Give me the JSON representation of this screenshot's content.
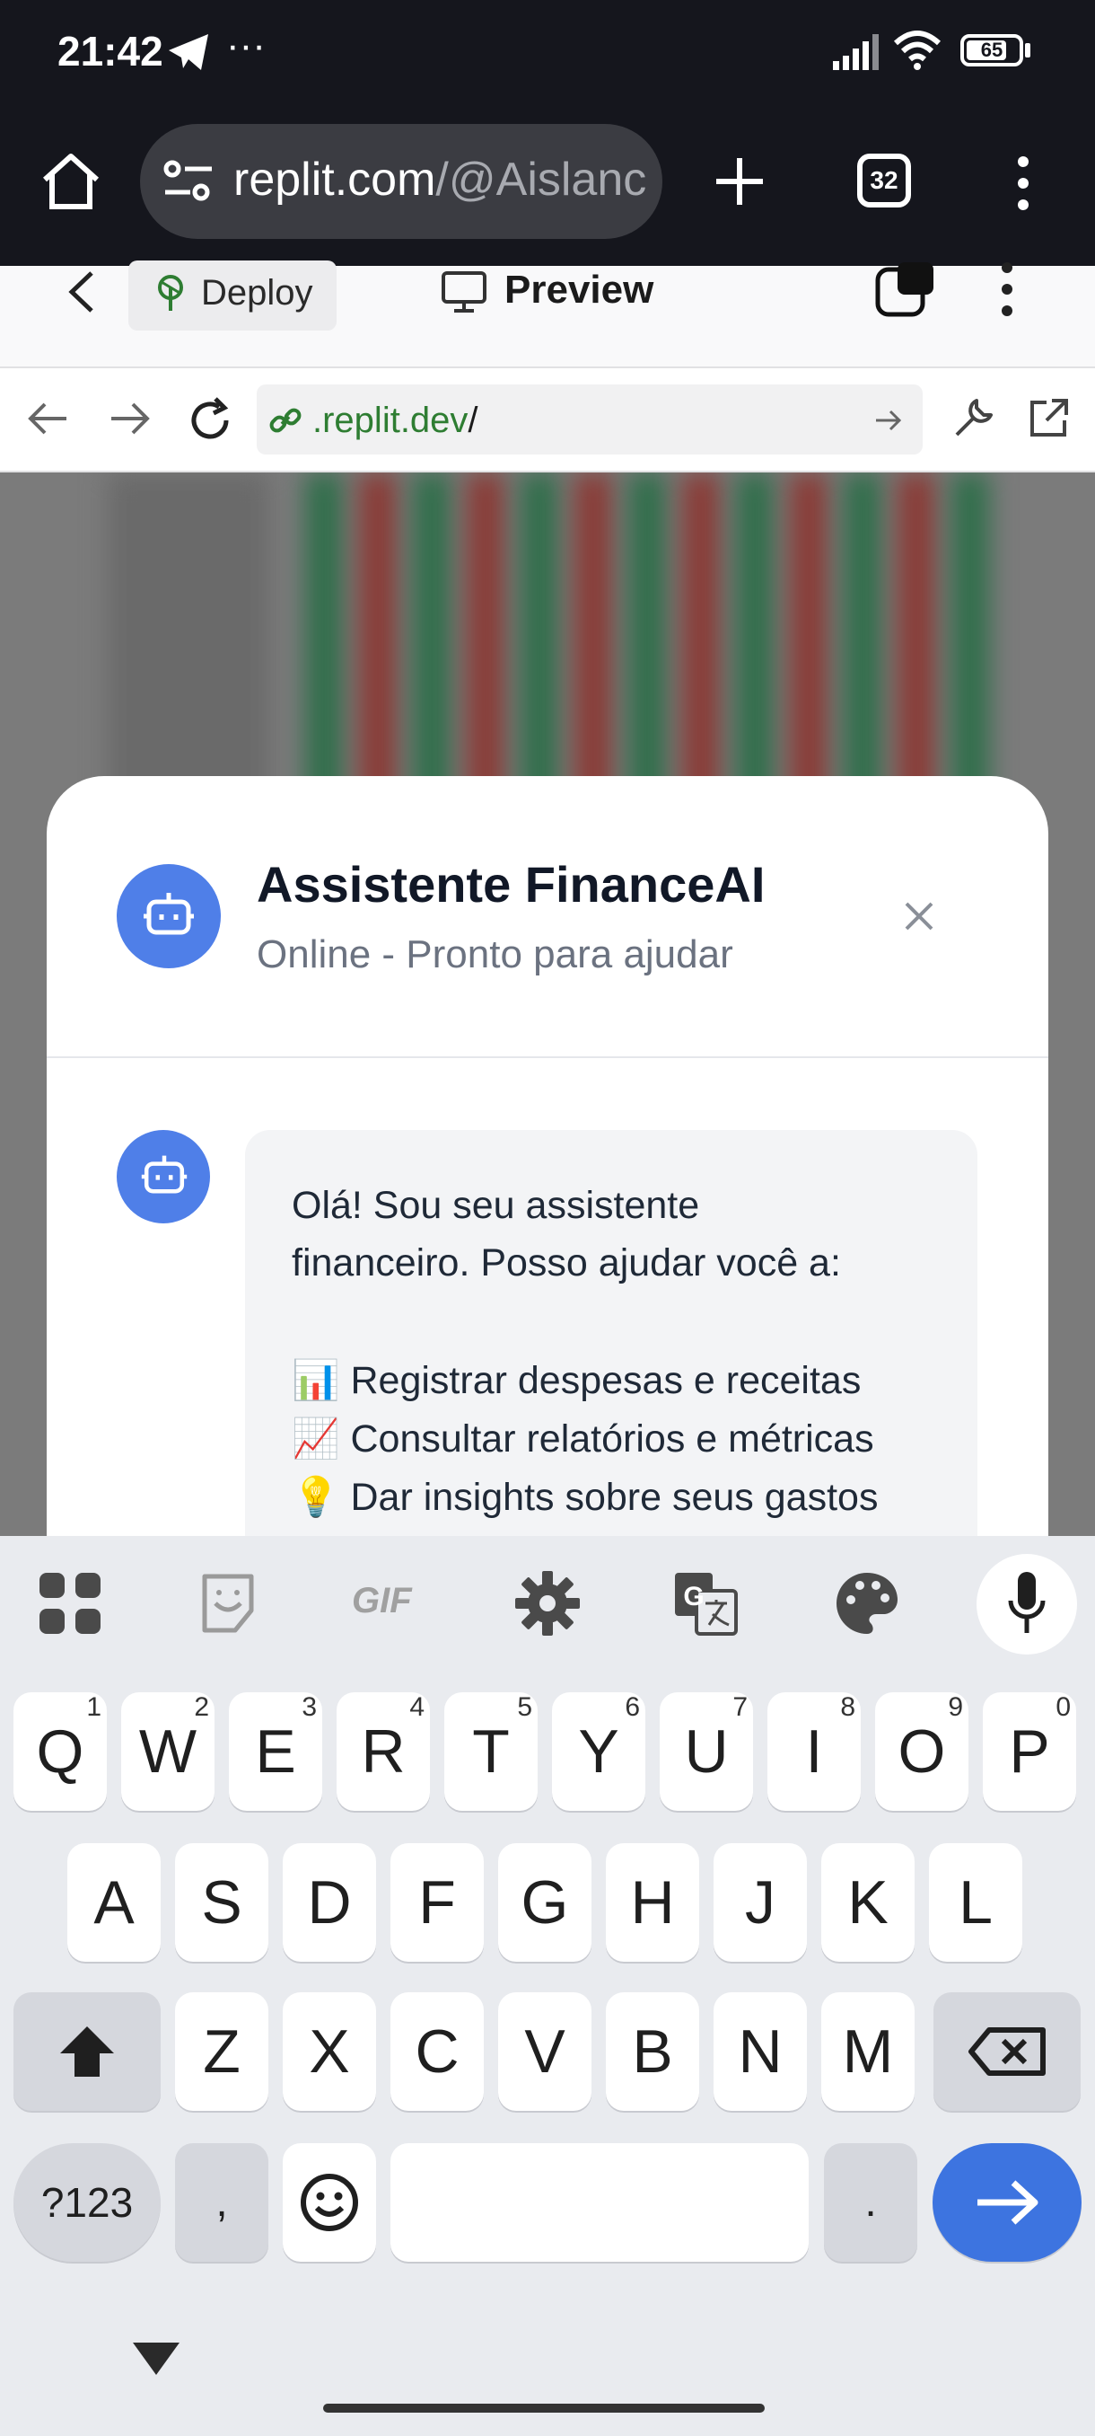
{
  "status_bar": {
    "time": "21:42",
    "more": "···",
    "battery": "65"
  },
  "browser": {
    "url_host": "replit.com",
    "url_path": "/@Aislanc",
    "tab_count": "32"
  },
  "replit": {
    "deploy_label": "Deploy",
    "preview_label": "Preview"
  },
  "address": {
    "domain": ".replit.dev",
    "slash": "/"
  },
  "modal": {
    "title": "Assistente FinanceAI",
    "subtitle": "Online - Pronto para ajudar",
    "message_lines": [
      "Olá! Sou seu assistente",
      "financeiro. Posso ajudar você a:",
      "📊 Registrar despesas e receitas",
      "📈 Consultar relatórios e métricas",
      "💡 Dar insights sobre seus gastos"
    ]
  },
  "keyboard": {
    "row1": [
      {
        "label": "Q",
        "hint": "1"
      },
      {
        "label": "W",
        "hint": "2"
      },
      {
        "label": "E",
        "hint": "3"
      },
      {
        "label": "R",
        "hint": "4"
      },
      {
        "label": "T",
        "hint": "5"
      },
      {
        "label": "Y",
        "hint": "6"
      },
      {
        "label": "U",
        "hint": "7"
      },
      {
        "label": "I",
        "hint": "8"
      },
      {
        "label": "O",
        "hint": "9"
      },
      {
        "label": "P",
        "hint": "0"
      }
    ],
    "row2": [
      "A",
      "S",
      "D",
      "F",
      "G",
      "H",
      "J",
      "K",
      "L"
    ],
    "row3": [
      "Z",
      "X",
      "C",
      "V",
      "B",
      "N",
      "M"
    ],
    "symbols_label": "?123",
    "comma_label": ",",
    "period_label": ".",
    "gif_label": "GIF"
  },
  "colors": {
    "accent": "#3d74e0",
    "avatar": "#4f7fe8",
    "dark_bar": "#15161d"
  }
}
